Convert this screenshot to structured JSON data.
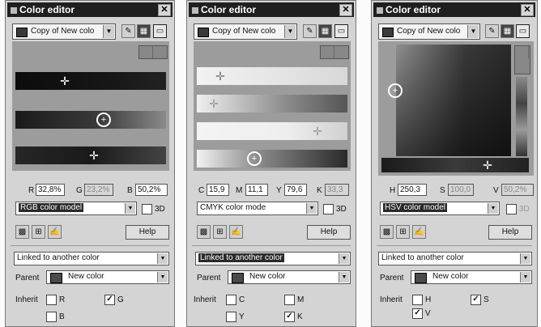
{
  "panels": [
    {
      "title": "Color editor",
      "color_name": "Copy of New colo",
      "model": "RGB color model",
      "components": [
        {
          "label": "R",
          "value": "32,8%",
          "enabled": true
        },
        {
          "label": "G",
          "value": "23,2%",
          "enabled": false
        },
        {
          "label": "B",
          "value": "50,2%",
          "enabled": true
        }
      ],
      "three_d_label": "3D",
      "help_label": "Help",
      "link_mode": "Linked to another color",
      "parent_label": "Parent",
      "parent_name": "New color",
      "inherit_label": "Inherit",
      "inherit": [
        {
          "label": "R",
          "checked": false
        },
        {
          "label": "G",
          "checked": true
        },
        {
          "label": "B",
          "checked": false
        }
      ]
    },
    {
      "title": "Color editor",
      "color_name": "Copy of New colo",
      "model": "CMYK color mode",
      "components": [
        {
          "label": "C",
          "value": "15,9",
          "enabled": true
        },
        {
          "label": "M",
          "value": "11,1",
          "enabled": true
        },
        {
          "label": "Y",
          "value": "79,6",
          "enabled": true
        },
        {
          "label": "K",
          "value": "33,3",
          "enabled": false
        }
      ],
      "three_d_label": "3D",
      "help_label": "Help",
      "link_mode": "Linked to another color",
      "parent_label": "Parent",
      "parent_name": "New color",
      "inherit_label": "Inherit",
      "inherit": [
        {
          "label": "C",
          "checked": false
        },
        {
          "label": "M",
          "checked": false
        },
        {
          "label": "Y",
          "checked": false
        },
        {
          "label": "K",
          "checked": true
        }
      ]
    },
    {
      "title": "Color editor",
      "color_name": "Copy of New colo",
      "model": "HSV color model",
      "components": [
        {
          "label": "H",
          "value": "250,3",
          "enabled": true
        },
        {
          "label": "S",
          "value": "100,0",
          "enabled": false
        },
        {
          "label": "V",
          "value": "50,2%",
          "enabled": false
        }
      ],
      "three_d_label": "3D",
      "help_label": "Help",
      "link_mode": "Linked to another color",
      "parent_label": "Parent",
      "parent_name": "New color",
      "inherit_label": "Inherit",
      "inherit": [
        {
          "label": "H",
          "checked": false
        },
        {
          "label": "S",
          "checked": true
        },
        {
          "label": "V",
          "checked": true
        }
      ]
    }
  ],
  "icons": {
    "close": "close-icon",
    "eyedropper": "eyedropper-icon",
    "palette": "palette-icon",
    "mode": "mode-toggle-icon",
    "grid": "grid-icon",
    "add": "add-color-icon",
    "edit": "edit-color-icon"
  }
}
